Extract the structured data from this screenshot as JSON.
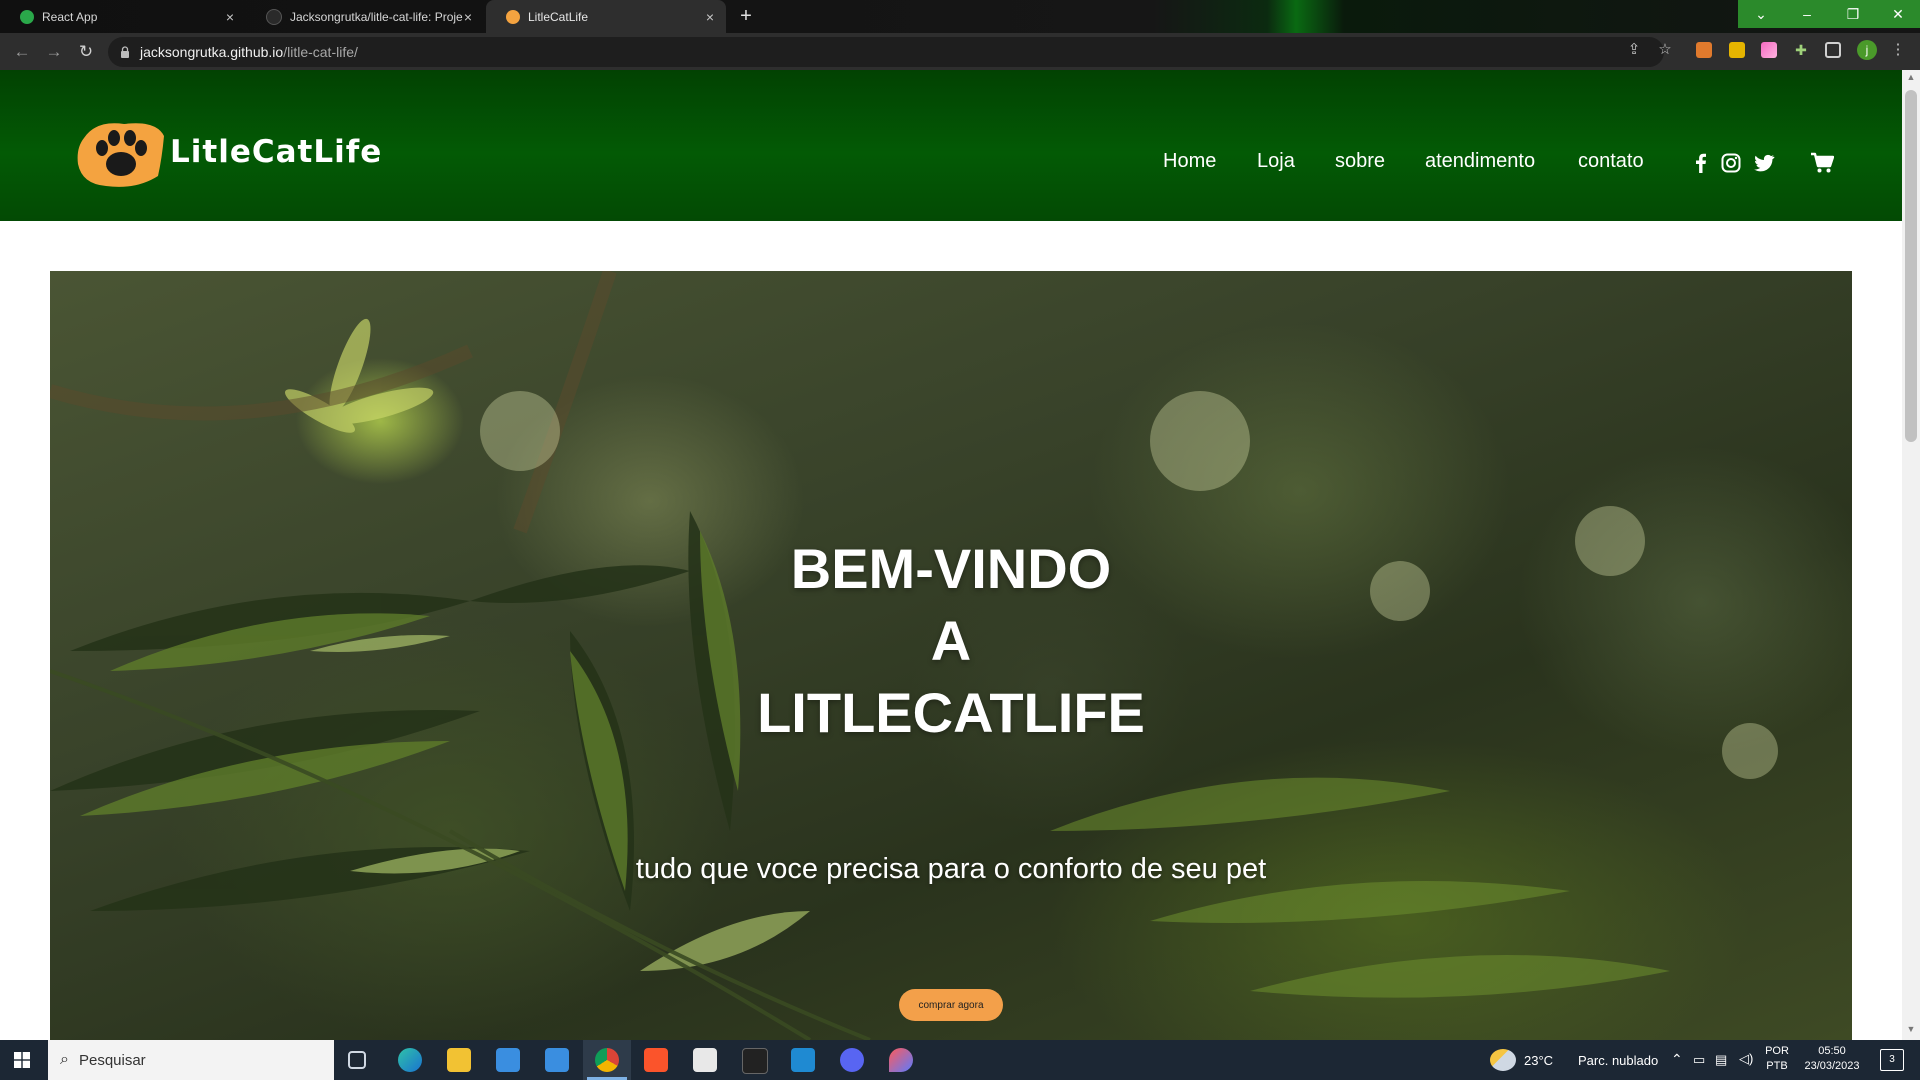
{
  "browser": {
    "tabs": [
      {
        "title": "React App",
        "close": "×"
      },
      {
        "title": "Jacksongrutka/litle-cat-life: Proje",
        "close": "×"
      },
      {
        "title": "LitleCatLife",
        "close": "×"
      }
    ],
    "new_tab": "+",
    "window_controls": {
      "minimize": "–",
      "restore": "❐",
      "close": "✕",
      "dropdown": "⌄"
    },
    "address": {
      "host": "jacksongrutka.github.io",
      "path": "/litle-cat-life/"
    },
    "profile_initial": "j"
  },
  "site": {
    "brand": "LitleCatLife",
    "nav": [
      "Home",
      "Loja",
      "sobre",
      "atendimento",
      "contato"
    ],
    "social_icons": [
      "facebook-icon",
      "instagram-icon",
      "twitter-icon"
    ],
    "cart_icon": "cart-icon",
    "hero": {
      "title_lines": [
        "BEM-VINDO",
        "A",
        "LITLECATLIFE"
      ],
      "subtitle": "tudo que voce precisa para o conforto de seu pet",
      "cta": "comprar agora"
    },
    "colors": {
      "header_green": "#035a05",
      "cta_orange": "#f3a04a",
      "logo_orange": "#f4a340"
    }
  },
  "taskbar": {
    "search_placeholder": "Pesquisar",
    "weather": {
      "temp": "23°C",
      "desc": "Parc. nublado"
    },
    "lang": {
      "line1": "POR",
      "line2": "PTB"
    },
    "clock": {
      "time": "05:50",
      "date": "23/03/2023"
    },
    "notifications_count": "3"
  }
}
